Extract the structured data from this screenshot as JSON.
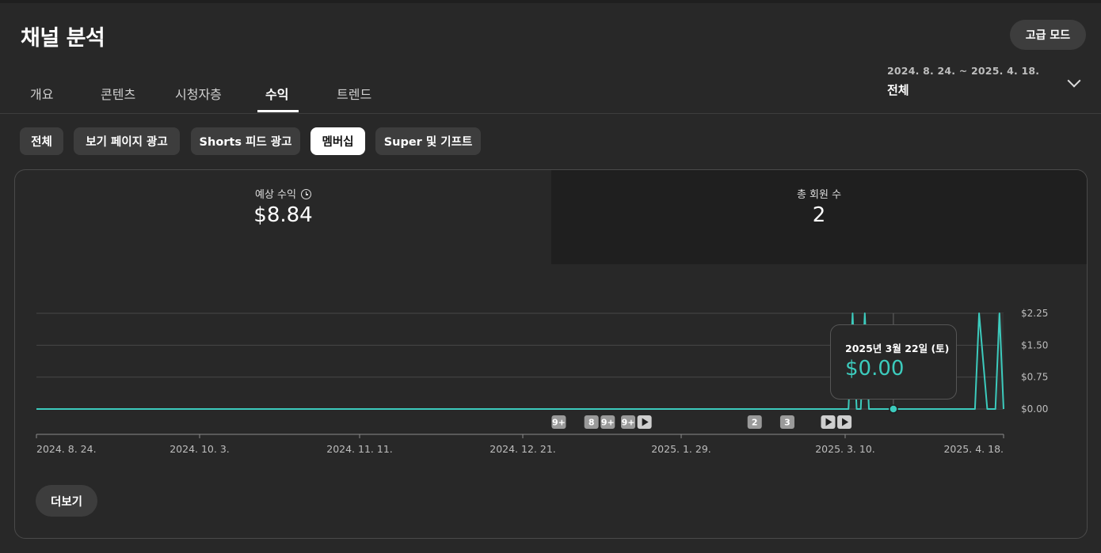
{
  "header": {
    "title": "채널 분석",
    "advanced_mode": "고급 모드"
  },
  "tabs": [
    {
      "label": "개요"
    },
    {
      "label": "콘텐츠"
    },
    {
      "label": "시청자층"
    },
    {
      "label": "수익"
    },
    {
      "label": "트렌드"
    }
  ],
  "date_picker": {
    "range": "2024. 8. 24. ~ 2025. 4. 18.",
    "period": "전체"
  },
  "chips": [
    {
      "label": "전체"
    },
    {
      "label": "보기 페이지 광고"
    },
    {
      "label": "Shorts 피드 광고"
    },
    {
      "label": "멤버십"
    },
    {
      "label": "Super 및 기프트"
    }
  ],
  "metrics": {
    "revenue_label": "예상 수익",
    "revenue_value": "$8.84",
    "members_label": "총 회원 수",
    "members_value": "2"
  },
  "tooltip": {
    "date": "2025년 3월 22일 (토)",
    "value": "$0.00"
  },
  "more_button": "더보기",
  "colors": {
    "line": "#3ccbbd",
    "background": "#282828",
    "active_chip": "#ffffff"
  },
  "chart_data": {
    "type": "line",
    "x_start": "2024-08-24",
    "x_end": "2025-04-18",
    "x_tick_labels": [
      "2024. 8. 24.",
      "2024. 10. 3.",
      "2024. 11. 11.",
      "2024. 12. 21.",
      "2025. 1. 29.",
      "2025. 3. 10.",
      "2025. 4. 18."
    ],
    "y_tick_labels": [
      "$2.25",
      "$1.50",
      "$0.75",
      "$0.00"
    ],
    "ylim": [
      0,
      2.25
    ],
    "grid": true,
    "series": [
      {
        "points": [
          [
            "2024-08-24",
            0
          ],
          [
            "2025-03-11",
            0
          ],
          [
            "2025-03-12",
            2.25
          ],
          [
            "2025-03-13",
            0
          ],
          [
            "2025-03-14",
            0
          ],
          [
            "2025-03-15",
            2.25
          ],
          [
            "2025-03-16",
            0
          ],
          [
            "2025-04-11",
            0
          ],
          [
            "2025-04-12",
            2.25
          ],
          [
            "2025-04-14",
            0
          ],
          [
            "2025-04-16",
            0
          ],
          [
            "2025-04-17",
            2.25
          ],
          [
            "2025-04-18",
            0
          ]
        ]
      }
    ],
    "hover_point": [
      "2025-03-22",
      0
    ],
    "markers": [
      {
        "date": "2024-12-30",
        "type": "badge",
        "label": "9+"
      },
      {
        "date": "2025-01-07",
        "type": "badge",
        "label": "8"
      },
      {
        "date": "2025-01-11",
        "type": "badge",
        "label": "9+"
      },
      {
        "date": "2025-01-16",
        "type": "badge",
        "label": "9+"
      },
      {
        "date": "2025-01-20",
        "type": "play",
        "label": ""
      },
      {
        "date": "2025-02-16",
        "type": "badge",
        "label": "2"
      },
      {
        "date": "2025-02-24",
        "type": "badge",
        "label": "3"
      },
      {
        "date": "2025-03-06",
        "type": "play",
        "label": ""
      },
      {
        "date": "2025-03-10",
        "type": "play",
        "label": ""
      }
    ]
  }
}
